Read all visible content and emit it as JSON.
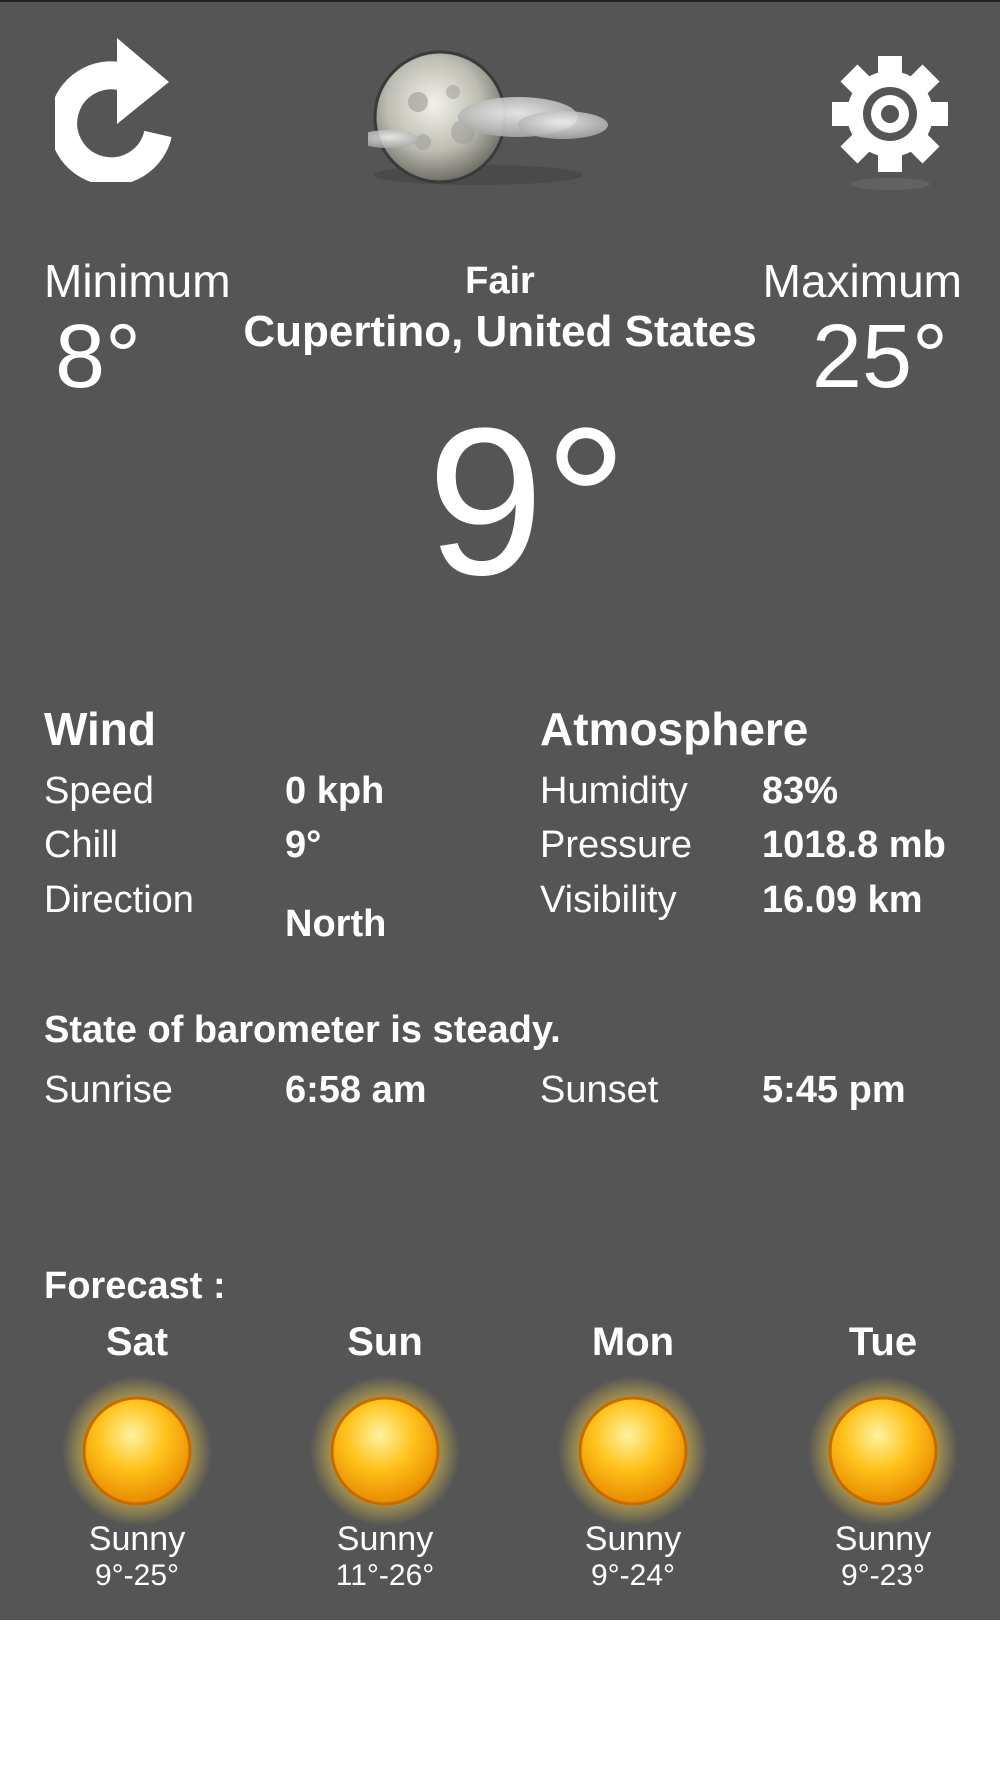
{
  "header": {
    "refresh_icon": "refresh-icon",
    "condition_icon": "moon-cloud-icon",
    "settings_icon": "gear-icon"
  },
  "current": {
    "minimum_label": "Minimum",
    "minimum_value": "8°",
    "maximum_label": "Maximum",
    "maximum_value": "25°",
    "condition": "Fair",
    "location": "Cupertino, United States",
    "temperature": "9°"
  },
  "wind": {
    "title": "Wind",
    "speed_label": "Speed",
    "speed_value": "0 kph",
    "chill_label": "Chill",
    "chill_value": "9°",
    "direction_label": "Direction",
    "direction_value": "North"
  },
  "atmosphere": {
    "title": "Atmosphere",
    "humidity_label": "Humidity",
    "humidity_value": "83%",
    "pressure_label": "Pressure",
    "pressure_value": "1018.8 mb",
    "visibility_label": "Visibility",
    "visibility_value": "16.09 km"
  },
  "barometer": {
    "state": "State of barometer is steady.",
    "sunrise_label": "Sunrise",
    "sunrise_value": "6:58 am",
    "sunset_label": "Sunset",
    "sunset_value": "5:45 pm"
  },
  "forecast": {
    "title": "Forecast :",
    "days": [
      {
        "name": "Sat",
        "condition": "Sunny",
        "range": "9°-25°",
        "icon": "sun-icon"
      },
      {
        "name": "Sun",
        "condition": "Sunny",
        "range": "11°-26°",
        "icon": "sun-icon"
      },
      {
        "name": "Mon",
        "condition": "Sunny",
        "range": "9°-24°",
        "icon": "sun-icon"
      },
      {
        "name": "Tue",
        "condition": "Sunny",
        "range": "9°-23°",
        "icon": "sun-icon"
      }
    ]
  },
  "colors": {
    "background": "#555555",
    "text": "#ffffff",
    "sun_orange": "#f5a400"
  }
}
